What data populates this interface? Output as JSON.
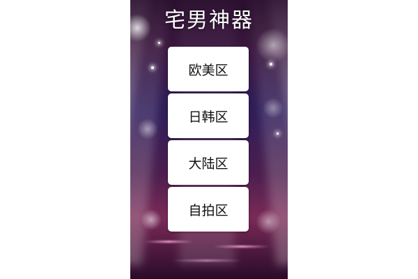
{
  "app": {
    "title": "宅男神器"
  },
  "menu": {
    "items": [
      {
        "label": "欧美区"
      },
      {
        "label": "日韩区"
      },
      {
        "label": "大陆区"
      },
      {
        "label": "自拍区"
      }
    ]
  },
  "theme": {
    "background_colors": [
      "#2a0f2e",
      "#2f1d5a",
      "#7a2a57"
    ],
    "button_background": "#ffffff",
    "title_color": "#ffffff"
  }
}
